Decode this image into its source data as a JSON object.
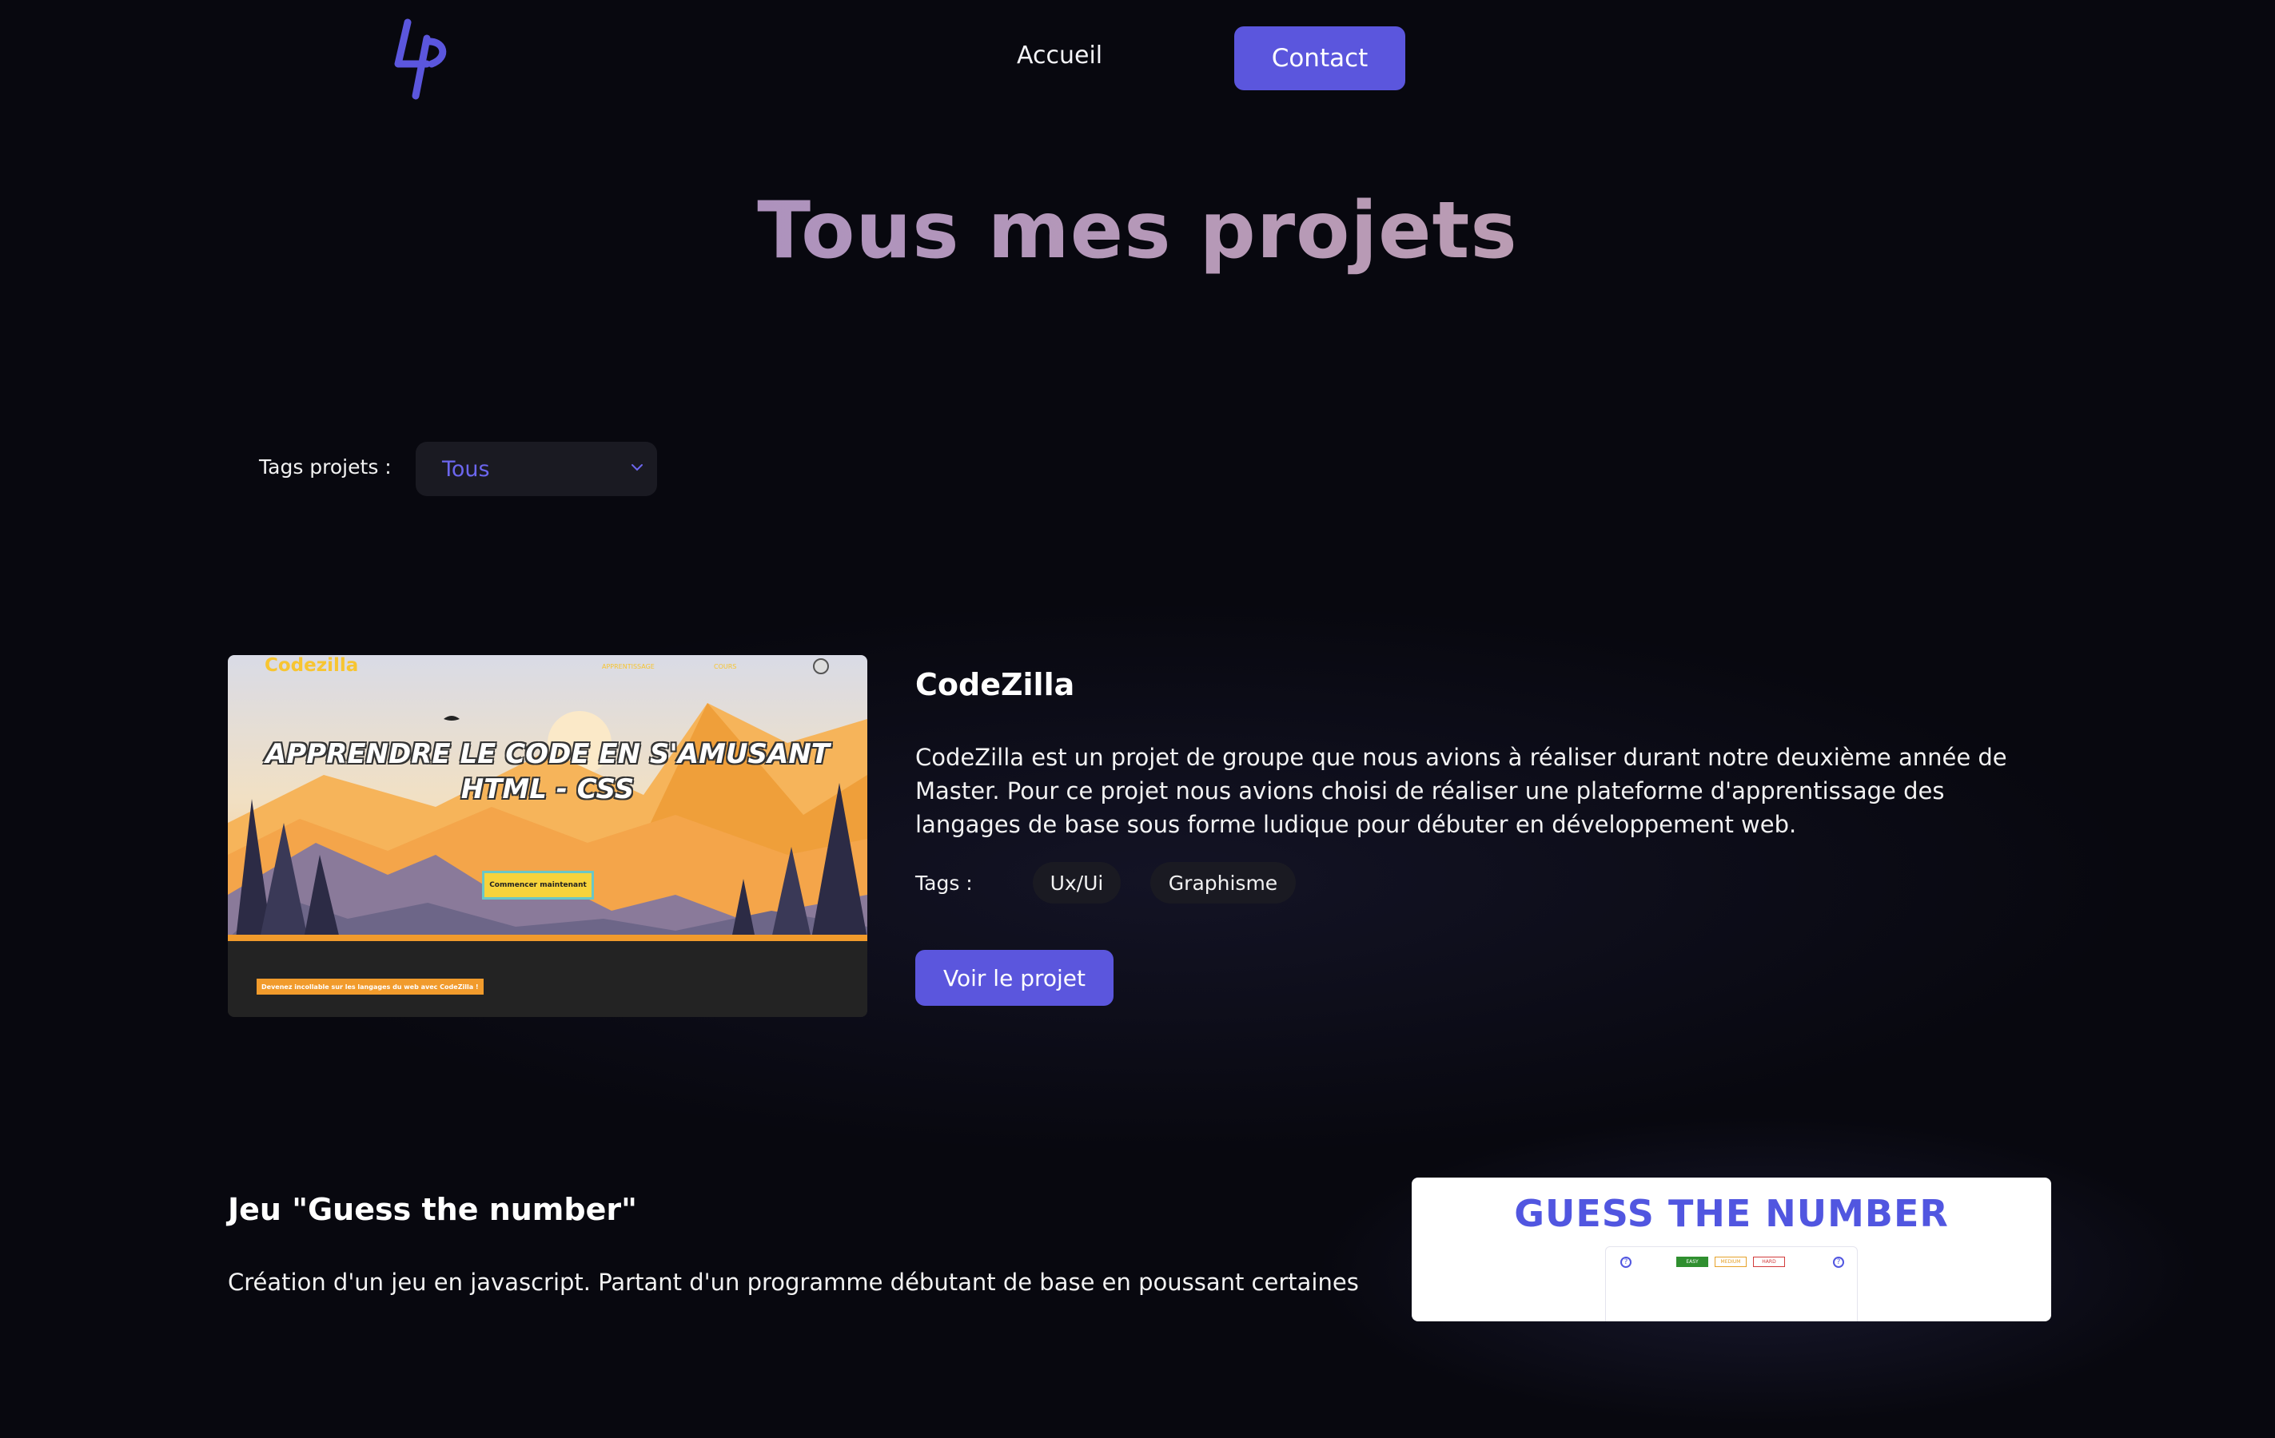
{
  "header": {
    "logo_icon": "lp-monogram-icon",
    "nav": {
      "home_label": "Accueil",
      "contact_label": "Contact"
    }
  },
  "page": {
    "title": "Tous mes projets"
  },
  "filter": {
    "label": "Tags projets :",
    "selected": "Tous",
    "icon": "chevron-down-icon"
  },
  "projects": [
    {
      "title": "CodeZilla",
      "description": "CodeZilla est un projet de groupe que nous avions à réaliser durant notre deuxième année de Master. Pour ce projet nous avions choisi de réaliser une plateforme d'apprentissage des langages de base sous forme ludique pour débuter en développement web.",
      "tags_label": "Tags :",
      "tags": [
        "Ux/Ui",
        "Graphisme"
      ],
      "button_label": "Voir le projet",
      "thumbnail": {
        "logo": "Codezilla",
        "nav": [
          "APPRENTISSAGE",
          "COURS"
        ],
        "headline_line1": "APPRENDRE LE CODE EN S'AMUSANT",
        "headline_line2": "HTML - CSS",
        "cta": "Commencer maintenant",
        "strip": "Devenez incollable sur les langages du web avec CodeZilla !"
      }
    },
    {
      "title": "Jeu \"Guess the number\"",
      "description": "Création d'un jeu en javascript. Partant d'un programme débutant de base en poussant certaines",
      "thumbnail": {
        "title": "GUESS THE NUMBER",
        "buttons": [
          "EASY",
          "MEDIUM",
          "HARD"
        ],
        "help_icon": "question-icon"
      }
    }
  ],
  "colors": {
    "accent": "#5b56dd",
    "background": "#08080f",
    "tag_bg": "#1a1a22"
  }
}
